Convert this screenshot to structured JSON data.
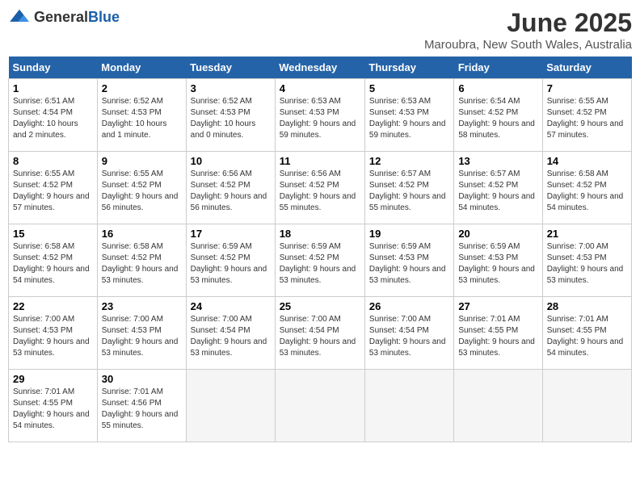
{
  "header": {
    "logo_general": "General",
    "logo_blue": "Blue",
    "month_title": "June 2025",
    "location": "Maroubra, New South Wales, Australia"
  },
  "days_of_week": [
    "Sunday",
    "Monday",
    "Tuesday",
    "Wednesday",
    "Thursday",
    "Friday",
    "Saturday"
  ],
  "weeks": [
    [
      {
        "date": "1",
        "sunrise": "6:51 AM",
        "sunset": "4:54 PM",
        "daylight": "10 hours and 2 minutes."
      },
      {
        "date": "2",
        "sunrise": "6:52 AM",
        "sunset": "4:53 PM",
        "daylight": "10 hours and 1 minute."
      },
      {
        "date": "3",
        "sunrise": "6:52 AM",
        "sunset": "4:53 PM",
        "daylight": "10 hours and 0 minutes."
      },
      {
        "date": "4",
        "sunrise": "6:53 AM",
        "sunset": "4:53 PM",
        "daylight": "9 hours and 59 minutes."
      },
      {
        "date": "5",
        "sunrise": "6:53 AM",
        "sunset": "4:53 PM",
        "daylight": "9 hours and 59 minutes."
      },
      {
        "date": "6",
        "sunrise": "6:54 AM",
        "sunset": "4:52 PM",
        "daylight": "9 hours and 58 minutes."
      },
      {
        "date": "7",
        "sunrise": "6:55 AM",
        "sunset": "4:52 PM",
        "daylight": "9 hours and 57 minutes."
      }
    ],
    [
      {
        "date": "8",
        "sunrise": "6:55 AM",
        "sunset": "4:52 PM",
        "daylight": "9 hours and 57 minutes."
      },
      {
        "date": "9",
        "sunrise": "6:55 AM",
        "sunset": "4:52 PM",
        "daylight": "9 hours and 56 minutes."
      },
      {
        "date": "10",
        "sunrise": "6:56 AM",
        "sunset": "4:52 PM",
        "daylight": "9 hours and 56 minutes."
      },
      {
        "date": "11",
        "sunrise": "6:56 AM",
        "sunset": "4:52 PM",
        "daylight": "9 hours and 55 minutes."
      },
      {
        "date": "12",
        "sunrise": "6:57 AM",
        "sunset": "4:52 PM",
        "daylight": "9 hours and 55 minutes."
      },
      {
        "date": "13",
        "sunrise": "6:57 AM",
        "sunset": "4:52 PM",
        "daylight": "9 hours and 54 minutes."
      },
      {
        "date": "14",
        "sunrise": "6:58 AM",
        "sunset": "4:52 PM",
        "daylight": "9 hours and 54 minutes."
      }
    ],
    [
      {
        "date": "15",
        "sunrise": "6:58 AM",
        "sunset": "4:52 PM",
        "daylight": "9 hours and 54 minutes."
      },
      {
        "date": "16",
        "sunrise": "6:58 AM",
        "sunset": "4:52 PM",
        "daylight": "9 hours and 53 minutes."
      },
      {
        "date": "17",
        "sunrise": "6:59 AM",
        "sunset": "4:52 PM",
        "daylight": "9 hours and 53 minutes."
      },
      {
        "date": "18",
        "sunrise": "6:59 AM",
        "sunset": "4:52 PM",
        "daylight": "9 hours and 53 minutes."
      },
      {
        "date": "19",
        "sunrise": "6:59 AM",
        "sunset": "4:53 PM",
        "daylight": "9 hours and 53 minutes."
      },
      {
        "date": "20",
        "sunrise": "6:59 AM",
        "sunset": "4:53 PM",
        "daylight": "9 hours and 53 minutes."
      },
      {
        "date": "21",
        "sunrise": "7:00 AM",
        "sunset": "4:53 PM",
        "daylight": "9 hours and 53 minutes."
      }
    ],
    [
      {
        "date": "22",
        "sunrise": "7:00 AM",
        "sunset": "4:53 PM",
        "daylight": "9 hours and 53 minutes."
      },
      {
        "date": "23",
        "sunrise": "7:00 AM",
        "sunset": "4:53 PM",
        "daylight": "9 hours and 53 minutes."
      },
      {
        "date": "24",
        "sunrise": "7:00 AM",
        "sunset": "4:54 PM",
        "daylight": "9 hours and 53 minutes."
      },
      {
        "date": "25",
        "sunrise": "7:00 AM",
        "sunset": "4:54 PM",
        "daylight": "9 hours and 53 minutes."
      },
      {
        "date": "26",
        "sunrise": "7:00 AM",
        "sunset": "4:54 PM",
        "daylight": "9 hours and 53 minutes."
      },
      {
        "date": "27",
        "sunrise": "7:01 AM",
        "sunset": "4:55 PM",
        "daylight": "9 hours and 53 minutes."
      },
      {
        "date": "28",
        "sunrise": "7:01 AM",
        "sunset": "4:55 PM",
        "daylight": "9 hours and 54 minutes."
      }
    ],
    [
      {
        "date": "29",
        "sunrise": "7:01 AM",
        "sunset": "4:55 PM",
        "daylight": "9 hours and 54 minutes."
      },
      {
        "date": "30",
        "sunrise": "7:01 AM",
        "sunset": "4:56 PM",
        "daylight": "9 hours and 55 minutes."
      },
      null,
      null,
      null,
      null,
      null
    ]
  ]
}
